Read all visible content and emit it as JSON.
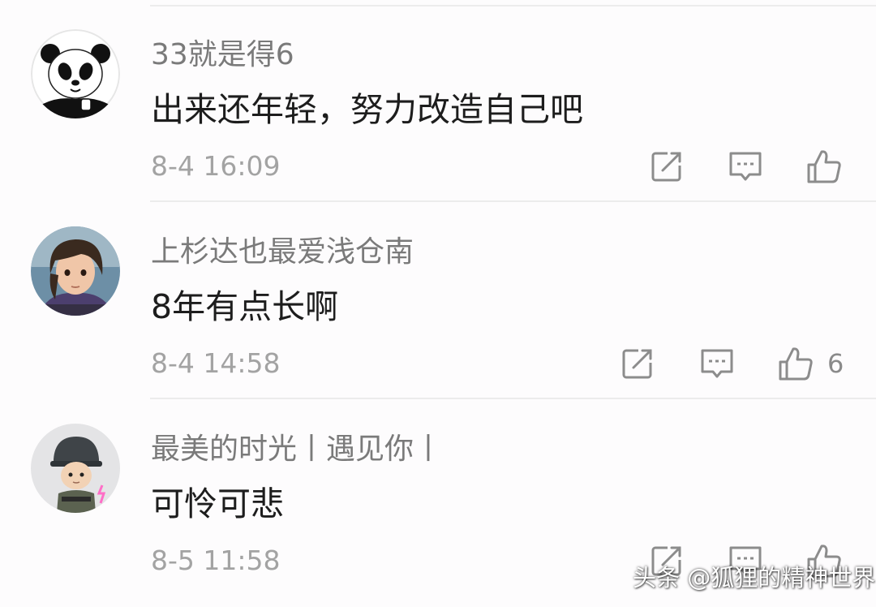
{
  "comments": [
    {
      "username": "33就是得6",
      "text": "出来还年轻，努力改造自己吧",
      "time": "8-4 16:09",
      "like_count": "",
      "avatar": "panda-avatar"
    },
    {
      "username": "上杉达也最爱浅仓南",
      "text": "8年有点长啊",
      "time": "8-4 14:58",
      "like_count": "6",
      "avatar": "anime-girl-avatar"
    },
    {
      "username": "最美的时光丨遇见你丨",
      "text": "可怜可悲",
      "time": "8-5 11:58",
      "like_count": "",
      "avatar": "helmet-soldier-avatar"
    }
  ],
  "actions": {
    "share_icon": "share-icon",
    "reply_icon": "comment-icon",
    "like_icon": "thumbs-up-icon"
  },
  "colors": {
    "username": "#7a7a7a",
    "content": "#1d1d1d",
    "time": "#a3a3a3",
    "icon": "#8c8c8c",
    "divider": "#ececec",
    "background": "#fdfcfd"
  },
  "watermark": "头条 @狐狸的精神世界"
}
